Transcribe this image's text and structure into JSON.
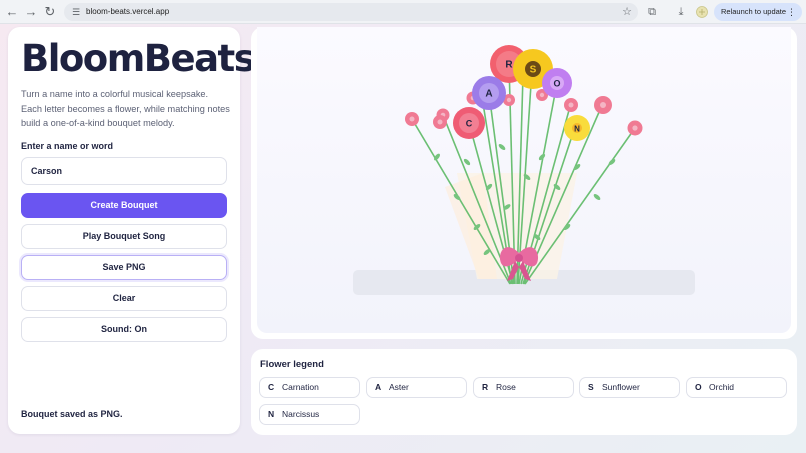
{
  "browser": {
    "url": "bloom-beats.vercel.app",
    "relaunch_label": "Relaunch to update",
    "icons": [
      "back-icon",
      "forward-icon",
      "reload-icon",
      "site-info-icon",
      "bookmark-star-icon",
      "extensions-icon",
      "download-icon",
      "profile-icon",
      "menu-icon"
    ]
  },
  "app": {
    "title": "BloomBeats",
    "description": "Turn a name into a colorful musical keepsake. Each letter becomes a flower, while matching notes build a one-of-a-kind bouquet melody.",
    "input_label": "Enter a name or word",
    "input_value": "Carson",
    "buttons": {
      "create": "Create Bouquet",
      "play": "Play Bouquet Song",
      "save": "Save PNG",
      "clear": "Clear",
      "sound": "Sound: On"
    },
    "status": "Bouquet saved as PNG.",
    "accent_color": "#6a55f1"
  },
  "bouquet": {
    "flowers": [
      {
        "letter": "R",
        "color": "#f2606e"
      },
      {
        "letter": "S",
        "color": "#f6c81f"
      },
      {
        "letter": "A",
        "color": "#9b7ce8"
      },
      {
        "letter": "O",
        "color": "#c07ef0"
      },
      {
        "letter": "C",
        "color": "#ef5c74"
      },
      {
        "letter": "N",
        "color": "#f9dc3c"
      }
    ],
    "ribbon_color": "#e86aa0"
  },
  "legend": {
    "title": "Flower legend",
    "items": [
      {
        "letter": "C",
        "name": "Carnation"
      },
      {
        "letter": "A",
        "name": "Aster"
      },
      {
        "letter": "R",
        "name": "Rose"
      },
      {
        "letter": "S",
        "name": "Sunflower"
      },
      {
        "letter": "O",
        "name": "Orchid"
      },
      {
        "letter": "N",
        "name": "Narcissus"
      }
    ]
  }
}
